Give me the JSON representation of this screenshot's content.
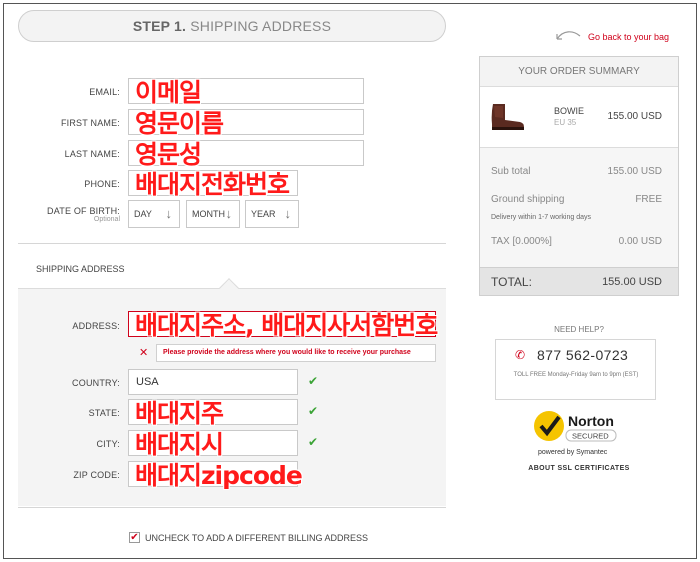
{
  "step": {
    "number": "STEP 1.",
    "title": "SHIPPING ADDRESS"
  },
  "nav": {
    "back_label": "Go back to your bag"
  },
  "form": {
    "email_label": "EMAIL:",
    "email_value": "이메일",
    "firstname_label": "FIRST NAME:",
    "firstname_value": "영문이름",
    "lastname_label": "LAST NAME:",
    "lastname_value": "영문성",
    "phone_label": "PHONE:",
    "phone_value": "배대지전화번호",
    "dob_label": "DATE OF BIRTH:",
    "dob_optional": "Optional",
    "dob_day": "DAY",
    "dob_month": "MONTH",
    "dob_year": "YEAR"
  },
  "shipping": {
    "section_label": "SHIPPING ADDRESS",
    "address_label": "ADDRESS:",
    "address_value": "배대지주소, 배대지사서함번호",
    "address_error": "Please provide the address where you would like to receive your purchase",
    "country_label": "COUNTRY:",
    "country_value": "USA",
    "state_label": "STATE:",
    "state_value": "배대지주",
    "city_label": "CITY:",
    "city_value": "배대지시",
    "zip_label": "ZIP CODE:",
    "zip_value": "배대지zipcode"
  },
  "billing": {
    "checkbox_label": "UNCHECK TO ADD A DIFFERENT BILLING ADDRESS",
    "checked": true
  },
  "summary": {
    "title": "YOUR ORDER SUMMARY",
    "product_name": "BOWIE",
    "product_size": "EU 35",
    "product_price": "155.00 USD",
    "subtotal_label": "Sub total",
    "subtotal_value": "155.00 USD",
    "shipping_label": "Ground shipping",
    "shipping_value": "FREE",
    "delivery_note": "Delivery  within 1-7 working days",
    "tax_label": "TAX [0.000%]",
    "tax_value": "0.00 USD",
    "total_label": "TOTAL:",
    "total_value": "155.00  USD"
  },
  "help": {
    "title": "NEED HELP?",
    "phone": "877 562-0723",
    "hours": "TOLL FREE Monday-Friday 9am to 9pm (EST)"
  },
  "trust": {
    "norton_brand": "Norton",
    "norton_secured": "SECURED",
    "norton_powered": "powered by Symantec",
    "ssl_link": "ABOUT SSL CERTIFICATES"
  },
  "colors": {
    "accent": "#d0021b",
    "check": "#3aa335",
    "annotation": "#ff1a1a"
  }
}
